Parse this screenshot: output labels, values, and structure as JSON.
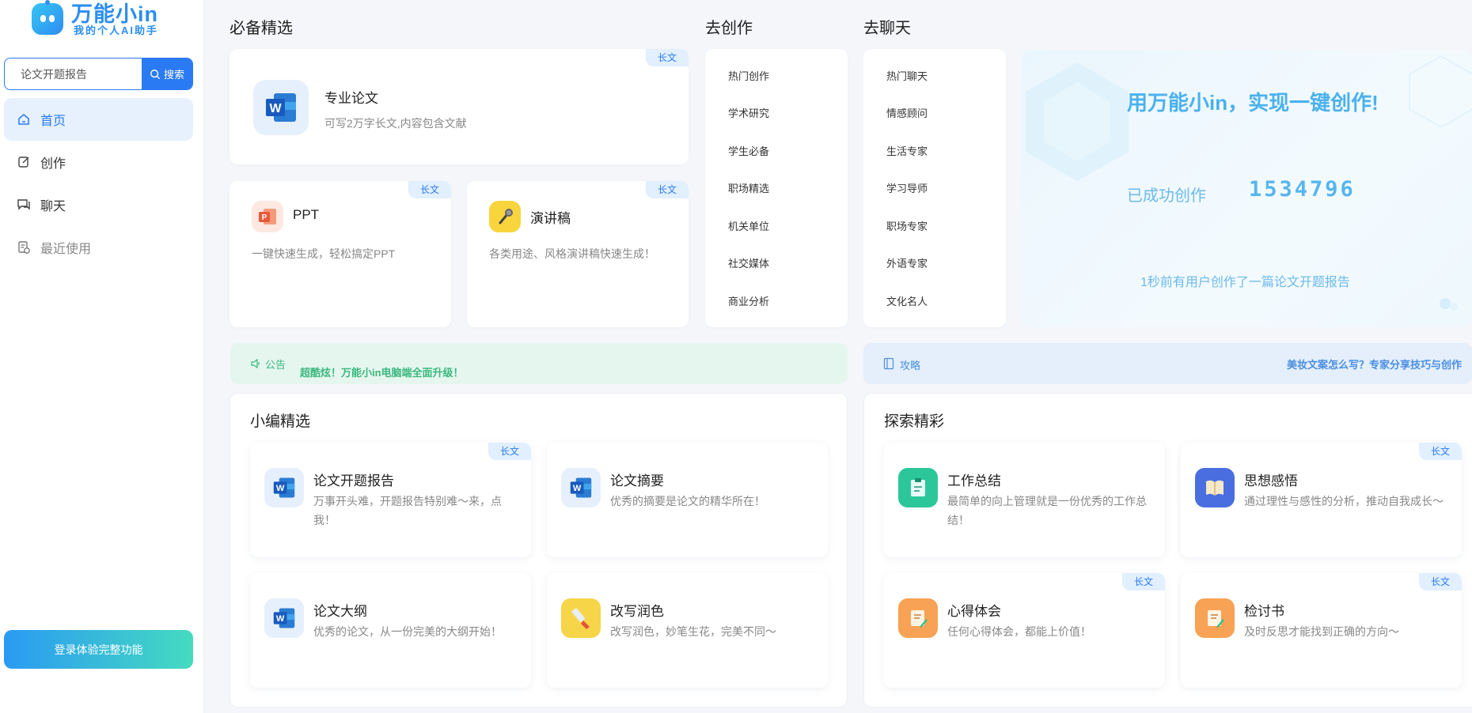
{
  "logo": {
    "title": "万能小in",
    "subtitle": "我的个人AI助手"
  },
  "search": {
    "value": "论文开题报告",
    "button_label": "搜索"
  },
  "nav": [
    {
      "label": "首页",
      "icon": "home-icon",
      "active": true
    },
    {
      "label": "创作",
      "icon": "edit-icon"
    },
    {
      "label": "聊天",
      "icon": "chat-icon"
    },
    {
      "label": "最近使用",
      "icon": "history-icon"
    }
  ],
  "login_label": "登录体验完整功能",
  "sections": {
    "essentials": "必备精选",
    "create": "去创作",
    "chat": "去聊天",
    "editor_picks": "小编精选",
    "explore": "探索精彩"
  },
  "long_tag": "长文",
  "essentials": {
    "thesis": {
      "title": "专业论文",
      "desc": "可写2万字长文,内容包含文献"
    },
    "ppt": {
      "title": "PPT",
      "desc": "一键快速生成，轻松搞定PPT"
    },
    "speech": {
      "title": "演讲稿",
      "desc": "各类用途、风格演讲稿快速生成！"
    }
  },
  "create_list": [
    "热门创作",
    "学术研究",
    "学生必备",
    "职场精选",
    "机关单位",
    "社交媒体",
    "商业分析"
  ],
  "chat_list": [
    "热门聊天",
    "情感顾问",
    "生活专家",
    "学习导师",
    "职场专家",
    "外语专家",
    "文化名人"
  ],
  "banner": {
    "title": "用万能小in，实现一键创作!",
    "count_label": "已成功创作",
    "count": "1534796",
    "live": "1秒前有用户创作了一篇论文开题报告"
  },
  "notice": {
    "label": "公告",
    "text": "超酷炫！万能小in电脑端全面升级！"
  },
  "strategy": {
    "label": "攻略",
    "text": "美妆文案怎么写？专家分享技巧与创作"
  },
  "editor_picks": [
    {
      "title": "论文开题报告",
      "desc": "万事开头难，开题报告特别难～来，点我！",
      "icon": "word-icon",
      "long": true
    },
    {
      "title": "论文摘要",
      "desc": "优秀的摘要是论文的精华所在！",
      "icon": "word-icon",
      "long": false
    },
    {
      "title": "论文大纲",
      "desc": "优秀的论文，从一份完美的大纲开始！",
      "icon": "word-icon",
      "long": false
    },
    {
      "title": "改写润色",
      "desc": "改写润色，妙笔生花，完美不同～",
      "icon": "brush-icon",
      "long": false
    }
  ],
  "explore": [
    {
      "title": "工作总结",
      "desc": "最简单的向上管理就是一份优秀的工作总结！",
      "icon": "clipboard-icon",
      "long": false
    },
    {
      "title": "思想感悟",
      "desc": "通过理性与感性的分析，推动自我成长～",
      "icon": "book-icon",
      "long": true
    },
    {
      "title": "心得体会",
      "desc": "任何心得体会，都能上价值！",
      "icon": "notes-icon",
      "long": true
    },
    {
      "title": "检讨书",
      "desc": "及时反思才能找到正确的方向～",
      "icon": "notes-icon",
      "long": true
    }
  ],
  "colors": {
    "accent": "#2a7af3",
    "banner_text": "#4ab1ee",
    "notice_bg": "#e5f6ef",
    "notice_text": "#3cb87e"
  }
}
